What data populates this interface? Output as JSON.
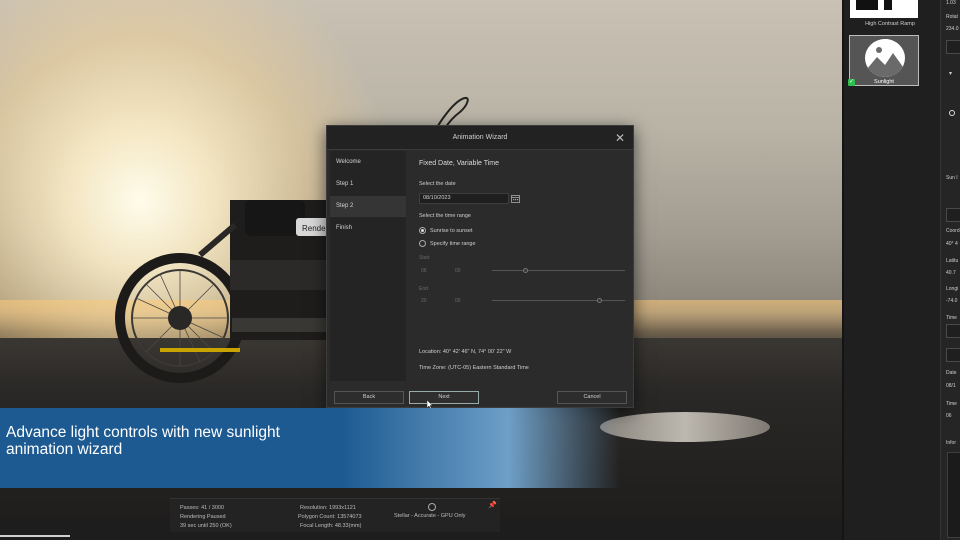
{
  "dialog": {
    "title": "Animation Wizard",
    "steps": [
      "Welcome",
      "Step 1",
      "Step 2",
      "Finish"
    ],
    "active_step": "Step 2",
    "heading": "Fixed Date, Variable Time",
    "select_date_label": "Select the date",
    "date_value": "08/10/2023",
    "select_time_range_label": "Select the time range",
    "radio_sunrise": "Sunrise to sunset",
    "radio_specify": "Specify time range",
    "start_label": "Start",
    "start_hour": "06",
    "start_min": "00",
    "end_label": "End",
    "end_hour": "20",
    "end_min": "00",
    "location": "Location:  40° 42' 46\" N, 74° 00' 22\" W",
    "time_zone": "Time Zone:  (UTC-05) Eastern Standard Time",
    "back_label": "Back",
    "next_label": "Next",
    "cancel_label": "Cancel"
  },
  "banner": {
    "text_line1": "Advance light controls with new sunlight",
    "text_line2": "animation wizard"
  },
  "scene": {
    "tag_text": "Render"
  },
  "status": {
    "passes": "Passes: 41 / 3000",
    "rendering": "Rendering Paused",
    "time_left": "39 sec until 250 (OK)",
    "resolution": "Resolution: 1993x1121",
    "polygon_count": "Polygon Count: 13574073",
    "focal_length": "Focal Length: 48.33(mm)",
    "mode": "Stellar - Accurate - GPU Only"
  },
  "side_panel": {
    "high_contrast_label": "High Contrast Ramp",
    "sunlight_label": "Sunlight"
  },
  "right_panel": {
    "rotate_label": "Rotat",
    "rotate_value": "234.0",
    "sun_label": "Sun I",
    "coord_label": "Coord",
    "coord_value": "40° 4",
    "latitude_label": "Latitu",
    "latitude_value": "40.7",
    "longitude_label": "Longi",
    "longitude_value": "-74.0",
    "time_label": "Time",
    "date_label": "Date",
    "date_value": "08/1",
    "time2_label": "Time",
    "time2_value": "06",
    "info_label": "Infor",
    "top_value": "1.03"
  },
  "colors": {
    "banner_blue": "#1c5a91",
    "dialog_bg": "#2b2b2b",
    "check_green": "#2fbf4d"
  }
}
